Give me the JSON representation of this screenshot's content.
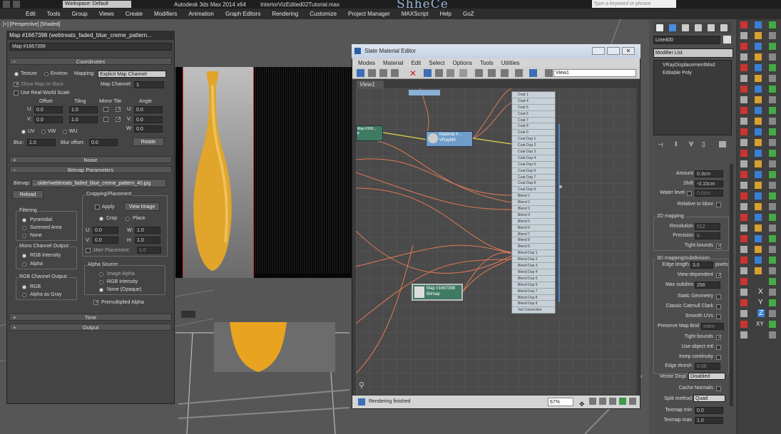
{
  "window": {
    "workspace": "Workspace: Default",
    "app_title": "Autodesk 3ds Max  2014 x64",
    "file_name": "InteriorVizEdited02Tutorial.max",
    "logo_text": "ShheCe",
    "search_placeholder": "Type a keyword or phrase"
  },
  "menu": [
    "Edit",
    "Tools",
    "Group",
    "Views",
    "Create",
    "Modifiers",
    "Animation",
    "Graph Editors",
    "Rendering",
    "Customize",
    "Project Manager",
    "MAXScript",
    "Help",
    "GoZ"
  ],
  "viewport": {
    "label": "[+] [Perspective] [Shaded]"
  },
  "map_panel": {
    "title": "Map #1667398 (webtreats_faded_blue_creme_pattern...",
    "map_name": "Map #1667398",
    "coordinates": {
      "header": "Coordinates",
      "texture": "Texture",
      "environ": "Environ",
      "mapping_label": "Mapping:",
      "mapping_value": "Explicit Map Channel",
      "show_map_on_back": "Show Map on Back",
      "map_channel_label": "Map Channel:",
      "map_channel_value": "1",
      "use_real_world_scale": "Use Real-World Scale",
      "offset": "Offset",
      "tiling": "Tiling",
      "mirror_tile": "Mirror Tile",
      "angle": "Angle",
      "u": "U:",
      "v": "V:",
      "w": "W:",
      "offset_u": "0.0",
      "offset_v": "0.0",
      "tiling_u": "1.0",
      "tiling_v": "1.0",
      "angle_u": "0.0",
      "angle_v": "0.0",
      "angle_w": "0.0",
      "uv": "UV",
      "vw": "VW",
      "wu": "WU",
      "blur_label": "Blur:",
      "blur_value": "1.0",
      "blur_offset_label": "Blur offset:",
      "blur_offset_value": "0.0",
      "rotate": "Rotate"
    },
    "noise_header": "Noise",
    "bitmap_params": {
      "header": "Bitmap Parameters",
      "bitmap_label": "Bitmap:",
      "bitmap_path": "...older\\webtreats_faded_blue_creme_pattern_40.jpg",
      "reload": "Reload",
      "cropping_placement": "Cropping/Placement",
      "apply": "Apply",
      "view_image": "View Image",
      "crop": "Crop",
      "place": "Place",
      "u": "U:",
      "v": "V:",
      "w": "W:",
      "h": "H:",
      "u_value": "0.0",
      "v_value": "0.0",
      "w_value": "1.0",
      "h_value": "1.0",
      "jitter_placement": "Jitter Placement:",
      "jitter_value": "1.0",
      "filtering": "Filtering",
      "pyramidal": "Pyramidal",
      "summed_area": "Summed Area",
      "none": "None",
      "mono_channel_output": "Mono Channel Output:",
      "rgb_intensity": "RGB Intensity",
      "alpha": "Alpha",
      "alpha_source": "Alpha Source",
      "image_alpha": "Image Alpha",
      "alpha_rgb_intensity": "RGB Intensity",
      "none_opaque": "None (Opaque)",
      "rgb_channel_output": "RGB Channel Output:",
      "rgb": "RGB",
      "alpha_as_gray": "Alpha as Gray",
      "premultiplied_alpha": "Premultiplied Alpha"
    },
    "time_header": "Time",
    "output_header": "Output"
  },
  "slate": {
    "title": "Slate Material Editor",
    "menu": [
      "Modes",
      "Material",
      "Edit",
      "Select",
      "Options",
      "Tools",
      "Utilities"
    ],
    "view_field": "View1",
    "tab": "View1",
    "material_node": {
      "title": "Material #...",
      "subtitle": "VRayMtl"
    },
    "bitmap_node": {
      "title": "Map #1667398",
      "subtitle": "Bitmap"
    },
    "partial_node": {
      "title": "Map #166...",
      "subtitle": "ff"
    },
    "blend_slots": [
      "Coat 1",
      "Coat 4",
      "Coat 5",
      "Coat 6",
      "Coat 7",
      "Coat 8",
      "Coat 9",
      "Coat Dup 1",
      "Coat Dup 2",
      "Coat Dup 3",
      "Coat Dup 4",
      "Coat Dup 5",
      "Coat Dup 6",
      "Coat Dup 7",
      "Coat Dup 8",
      "Coat Dup 9",
      "Blend 1",
      "Blend 2",
      "Blend 3",
      "Blend 4",
      "Blend 5",
      "Blend 6",
      "Blend 7",
      "Blend 8",
      "Blend 9",
      "Blend Dup 1",
      "Blend Dup 2",
      "Blend Dup 3",
      "Blend Dup 4",
      "Blend Dup 5",
      "Blend Dup 6",
      "Blend Dup 7",
      "Blend Dup 8",
      "Blend Dup 9",
      "Val Connection"
    ],
    "status": "Rendering finished",
    "zoom": "67%"
  },
  "command_panel": {
    "object_name": "Line400",
    "modifier_list": "Modifier List",
    "stack": [
      "VRayDisplacementMod",
      "Editable Poly"
    ],
    "amount_label": "Amount",
    "amount_value": "0.3cm",
    "shift_label": "Shift",
    "shift_value": "-0.15cm",
    "water_level_label": "Water level",
    "water_level_value": "0.0cm",
    "relative_to_bbox": "Relative to bbox",
    "mapping_2d": "2D mapping",
    "resolution_label": "Resolution",
    "resolution_value": "512",
    "precision_label": "Precision",
    "precision_value": "8",
    "tight_bounds_1": "Tight bounds",
    "subdivision_3d": "3D mapping/subdivision",
    "edge_length_label": "Edge length",
    "edge_length_value": "3.0",
    "pixels": "pixels",
    "view_dependent": "View-dependent",
    "max_subdivs_label": "Max subdivs",
    "max_subdivs_value": "256",
    "static_geometry": "Static Geometry",
    "classic_catmull_clark": "Classic Catmull Clark",
    "smooth_uvs": "Smooth UVs",
    "preserve_map_bnd": "Preserve Map Bnd",
    "preserve_map_bnd_value": "Interr",
    "tight_bounds_2": "Tight bounds",
    "use_object_mtl": "Use object mtl",
    "keep_continuity": "Keep continuity",
    "edge_thresh_label": "Edge thresh",
    "edge_thresh_value": "0.05",
    "vector_displ_label": "Vector Displ",
    "vector_displ_value": "Disabled",
    "cache_normals": "Cache Normals",
    "split_method_label": "Split method",
    "split_method_value": "Quad",
    "texmap_min_label": "Texmap min",
    "texmap_min_value": "0.0",
    "texmap_max_label": "Texmap max",
    "texmap_max_value": "1.0"
  },
  "toolbar_letters": [
    "X",
    "Y",
    "Z",
    "XY"
  ]
}
